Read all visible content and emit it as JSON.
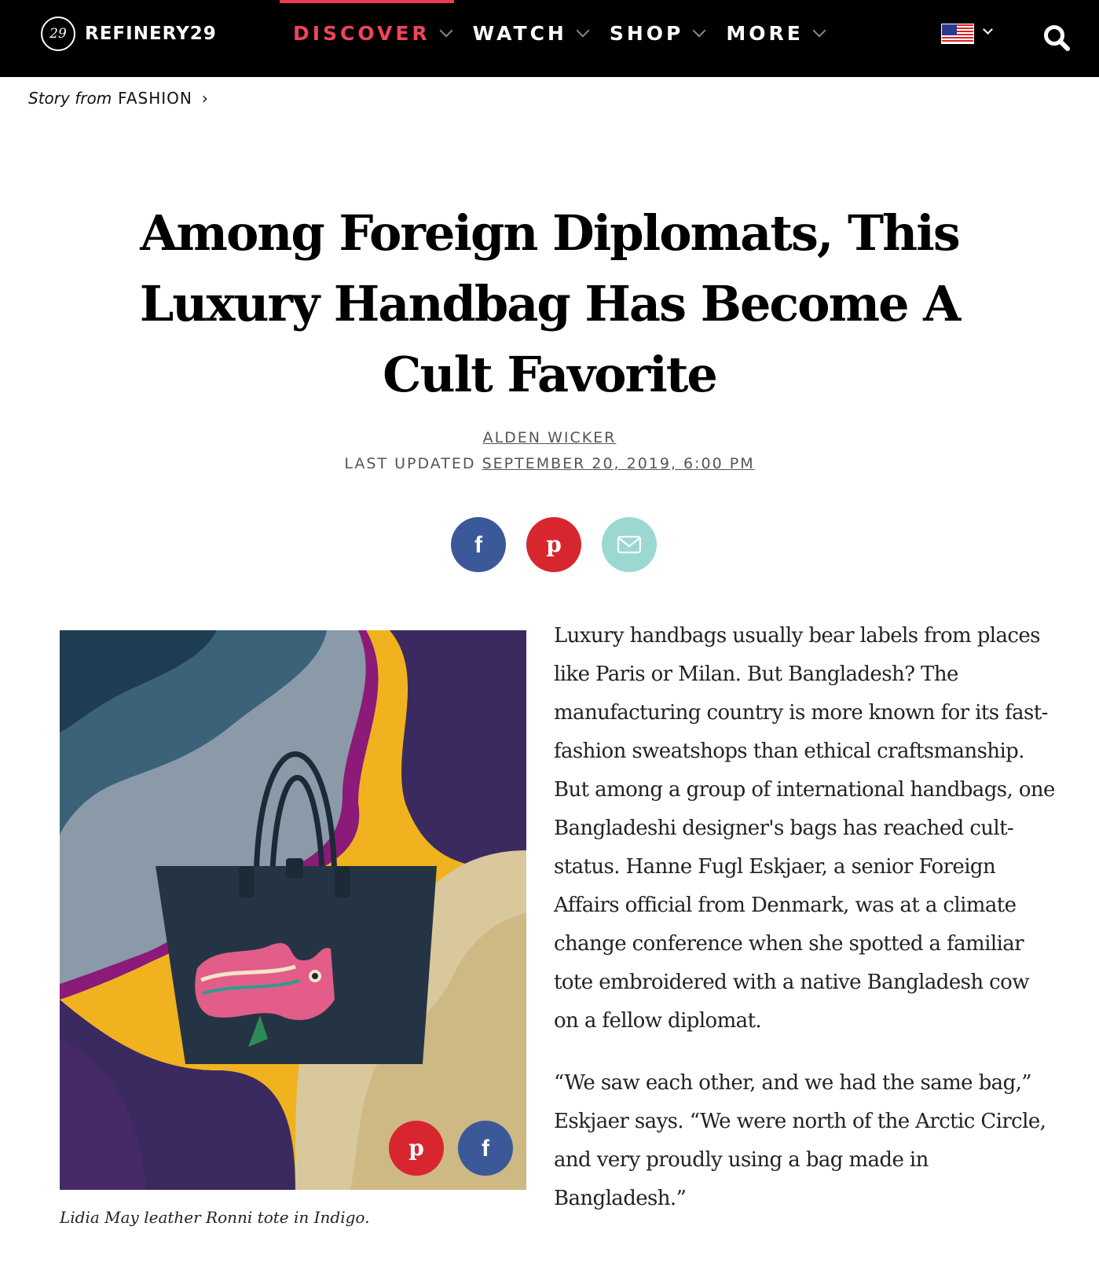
{
  "brand": {
    "logo_mark": "29",
    "name": "REFINERY29"
  },
  "nav": {
    "items": [
      {
        "label": "DISCOVER",
        "active": true
      },
      {
        "label": "WATCH",
        "active": false
      },
      {
        "label": "SHOP",
        "active": false
      },
      {
        "label": "MORE",
        "active": false
      }
    ],
    "region_icon": "us-flag-icon",
    "search_icon": "search-icon"
  },
  "breadcrumb": {
    "prefix": "Story from",
    "category": "FASHION",
    "arrow": "›"
  },
  "article": {
    "title": "Among Foreign Diplomats, This Luxury Handbag Has Become A Cult Favorite",
    "author": "ALDEN WICKER",
    "updated_label": "LAST UPDATED",
    "updated_date": "SEPTEMBER 20, 2019, 6:00 PM",
    "caption": "Lidia May leather Ronni tote in Indigo.",
    "paragraphs": [
      "Luxury handbags usually bear labels from places like Paris or Milan. But Bangladesh? The manufacturing country is more known for its fast-fashion sweatshops than ethical craftsmanship. But among a group of international handbags, one Bangladeshi designer's bags has reached cult-status. Hanne Fugl Eskjaer, a senior Foreign Affairs official from Denmark, was at a climate change conference when she spotted a familiar tote embroidered with a native Bangladesh cow on a fellow diplomat.",
      "“We saw each other, and we had the same bag,” Eskjaer says. “We were north of the Arctic Circle, and very proudly using a bag made in Bangladesh.”"
    ]
  },
  "colors": {
    "facebook": "#3b5998",
    "pinterest": "#d8262f",
    "email": "#9bd8d1",
    "nav_active": "#f0445a"
  }
}
